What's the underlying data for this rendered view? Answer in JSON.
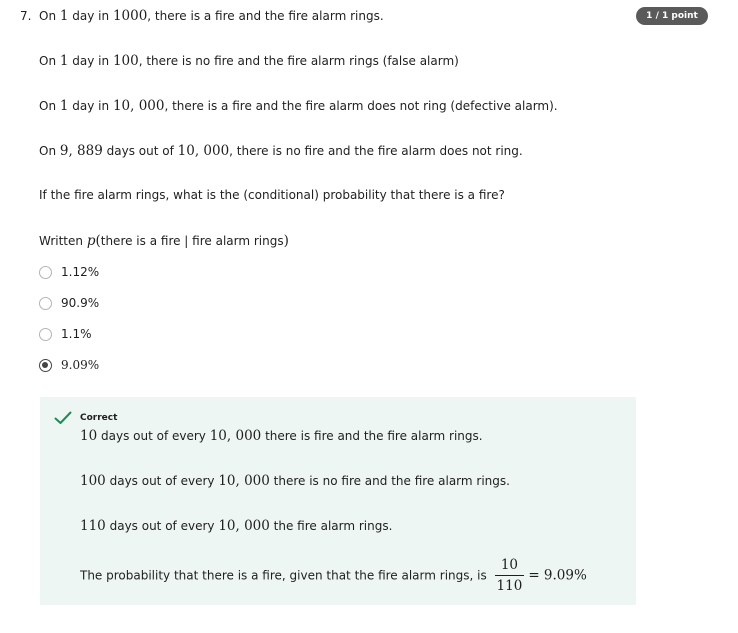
{
  "question": {
    "number": "7.",
    "points": "1 / 1 point",
    "p1": {
      "a": "On ",
      "m1": "1",
      "b": " day in ",
      "m2": "1000",
      "c": ", there is a fire and the fire alarm rings."
    },
    "p2": {
      "a": "On ",
      "m1": "1",
      "b": " day in ",
      "m2": "100",
      "c": ", there is no fire and the fire alarm rings (false alarm)"
    },
    "p3": {
      "a": "On ",
      "m1": "1",
      "b": " day in ",
      "m2": "10, 000",
      "c": ", there is a fire and the fire alarm does not ring (defective alarm)."
    },
    "p4": {
      "a": "On ",
      "m1": "9, 889",
      "b": " days out of ",
      "m2": "10, 000",
      "c": ", there is no fire and the fire alarm does not ring."
    },
    "p5": "If the fire alarm rings, what is the (conditional) probability that there is a fire?",
    "p6": {
      "a": "Written ",
      "m1": "p",
      "m2": "(",
      "b": "there is a fire | fire alarm rings",
      "m3": ")"
    }
  },
  "options": [
    {
      "label": "1.12%",
      "selected": false
    },
    {
      "label": "90.9%",
      "selected": false
    },
    {
      "label": "1.1%",
      "selected": false
    },
    {
      "label": "9.09%",
      "selected": true
    }
  ],
  "feedback": {
    "status": "Correct",
    "accent_color": "#1e8a5a",
    "f1": {
      "m1": "10",
      "a": " days out of every ",
      "m2": "10, 000",
      "b": " there is fire and the fire alarm rings."
    },
    "f2": {
      "m1": "100",
      "a": " days out of every ",
      "m2": "10, 000",
      "b": " there is no fire and the fire alarm rings."
    },
    "f3": {
      "m1": "110",
      "a": " days out of every ",
      "m2": "10, 000",
      "b": " the fire alarm rings."
    },
    "f4": {
      "a": "The probability that there is a fire, given that the fire alarm rings, is ",
      "num": "10",
      "den": "110",
      "result": "= 9.09%"
    }
  }
}
